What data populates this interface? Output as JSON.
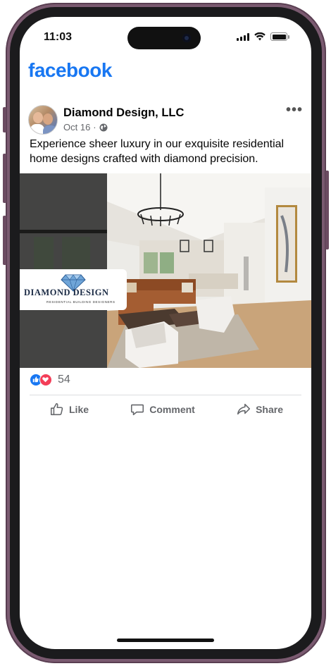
{
  "status_bar": {
    "time": "11:03"
  },
  "app": {
    "logo_text": "facebook"
  },
  "post": {
    "page_name": "Diamond Design, LLC",
    "date": "Oct 16",
    "separator": "·",
    "text": "Experience sheer luxury in our exquisite residential home designs crafted with diamond precision.",
    "image_logo": {
      "brand": "DIAMOND DESIGN",
      "tagline": "RESIDENTIAL BUILDING DESIGNERS"
    },
    "reaction_count": "54",
    "actions": [
      {
        "label": "Like",
        "icon": "like-icon"
      },
      {
        "label": "Comment",
        "icon": "comment-icon"
      },
      {
        "label": "Share",
        "icon": "share-icon"
      }
    ]
  },
  "colors": {
    "brand": "#1877f2",
    "love": "#f33e58",
    "frame": "#7a5a70"
  }
}
